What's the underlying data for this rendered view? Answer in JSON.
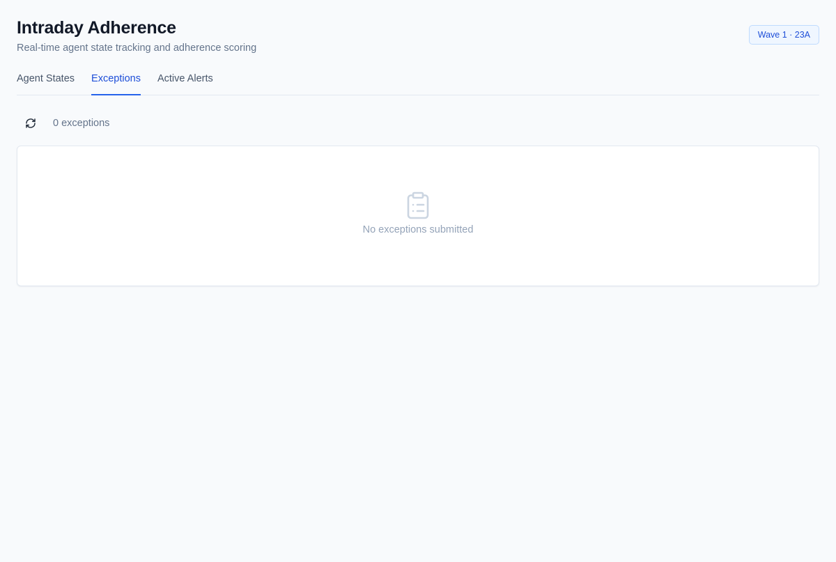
{
  "header": {
    "title": "Intraday Adherence",
    "subtitle": "Real-time agent state tracking and adherence scoring",
    "badge": "Wave 1 · 23A"
  },
  "tabs": [
    {
      "label": "Agent States",
      "active": false
    },
    {
      "label": "Exceptions",
      "active": true
    },
    {
      "label": "Active Alerts",
      "active": false
    }
  ],
  "toolbar": {
    "refresh_icon": "refresh-icon",
    "count_text": "0 exceptions"
  },
  "empty_state": {
    "icon": "clipboard-list-icon",
    "message": "No exceptions submitted"
  },
  "colors": {
    "accent": "#2563eb",
    "background": "#f8fafc",
    "muted_text": "#64748b",
    "empty_icon": "#cbd5e1"
  }
}
